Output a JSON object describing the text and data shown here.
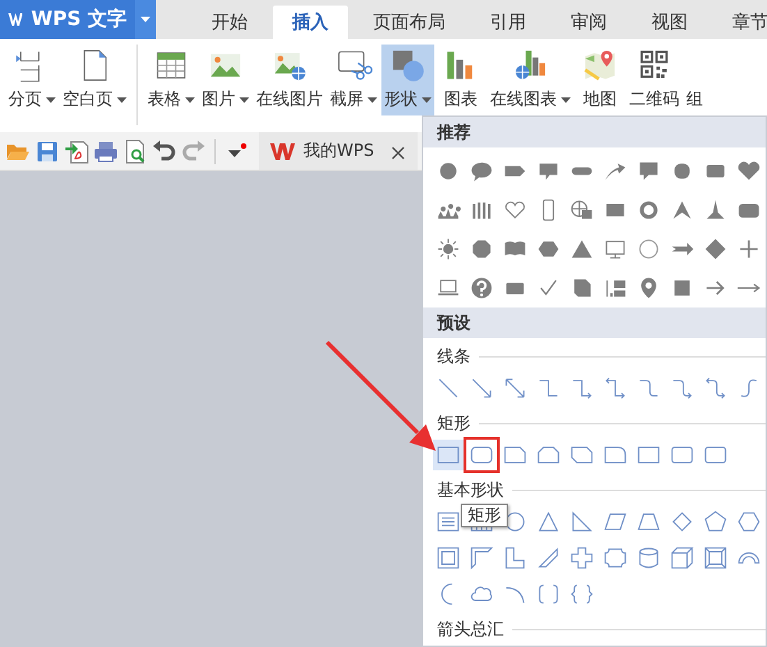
{
  "app_button": {
    "label": "WPS 文字"
  },
  "tabs": [
    {
      "label": "开始",
      "selected": false
    },
    {
      "label": "插入",
      "selected": true
    },
    {
      "label": "页面布局",
      "selected": false
    },
    {
      "label": "引用",
      "selected": false
    },
    {
      "label": "审阅",
      "selected": false
    },
    {
      "label": "视图",
      "selected": false
    },
    {
      "label": "章节",
      "selected": false
    }
  ],
  "ribbon": [
    {
      "label": "分页",
      "kind": "page-break",
      "dropdown": true,
      "selected": false
    },
    {
      "label": "空白页",
      "kind": "blank-page",
      "dropdown": true,
      "selected": false
    },
    {
      "label": "表格",
      "kind": "table",
      "dropdown": true,
      "selected": false
    },
    {
      "label": "图片",
      "kind": "picture",
      "dropdown": true,
      "selected": false
    },
    {
      "label": "在线图片",
      "kind": "online-picture",
      "dropdown": false,
      "selected": false
    },
    {
      "label": "截屏",
      "kind": "screenshot",
      "dropdown": true,
      "selected": false
    },
    {
      "label": "形状",
      "kind": "shapes",
      "dropdown": true,
      "selected": true
    },
    {
      "label": "图表",
      "kind": "chart",
      "dropdown": false,
      "selected": false
    },
    {
      "label": "在线图表",
      "kind": "online-chart",
      "dropdown": true,
      "selected": false
    },
    {
      "label": "地图",
      "kind": "map",
      "dropdown": false,
      "selected": false
    },
    {
      "label": "二维码",
      "kind": "qr",
      "dropdown": false,
      "selected": false
    },
    {
      "label": "组",
      "kind": "group",
      "dropdown": false,
      "selected": false
    }
  ],
  "doc_tabs": [
    {
      "label": "我的WPS"
    }
  ],
  "shape_panel": {
    "recommended_header": "推荐",
    "preset_header": "预设",
    "groups": [
      {
        "label": "线条",
        "kind": "lines"
      },
      {
        "label": "矩形",
        "kind": "rectangles",
        "shapes": [
          {
            "selected": true,
            "annotated": false
          },
          {
            "selected": false,
            "annotated": true
          },
          {
            "selected": false,
            "annotated": false
          },
          {
            "selected": false,
            "annotated": false
          },
          {
            "selected": false,
            "annotated": false
          },
          {
            "selected": false,
            "annotated": false
          },
          {
            "selected": false,
            "annotated": false
          },
          {
            "selected": false,
            "annotated": false
          },
          {
            "selected": false,
            "annotated": false
          }
        ]
      },
      {
        "label": "基本形状",
        "kind": "basic"
      },
      {
        "label": "箭头总汇",
        "kind": "arrows"
      }
    ]
  },
  "tooltip": "矩形",
  "annotation": {
    "arrow": true
  }
}
